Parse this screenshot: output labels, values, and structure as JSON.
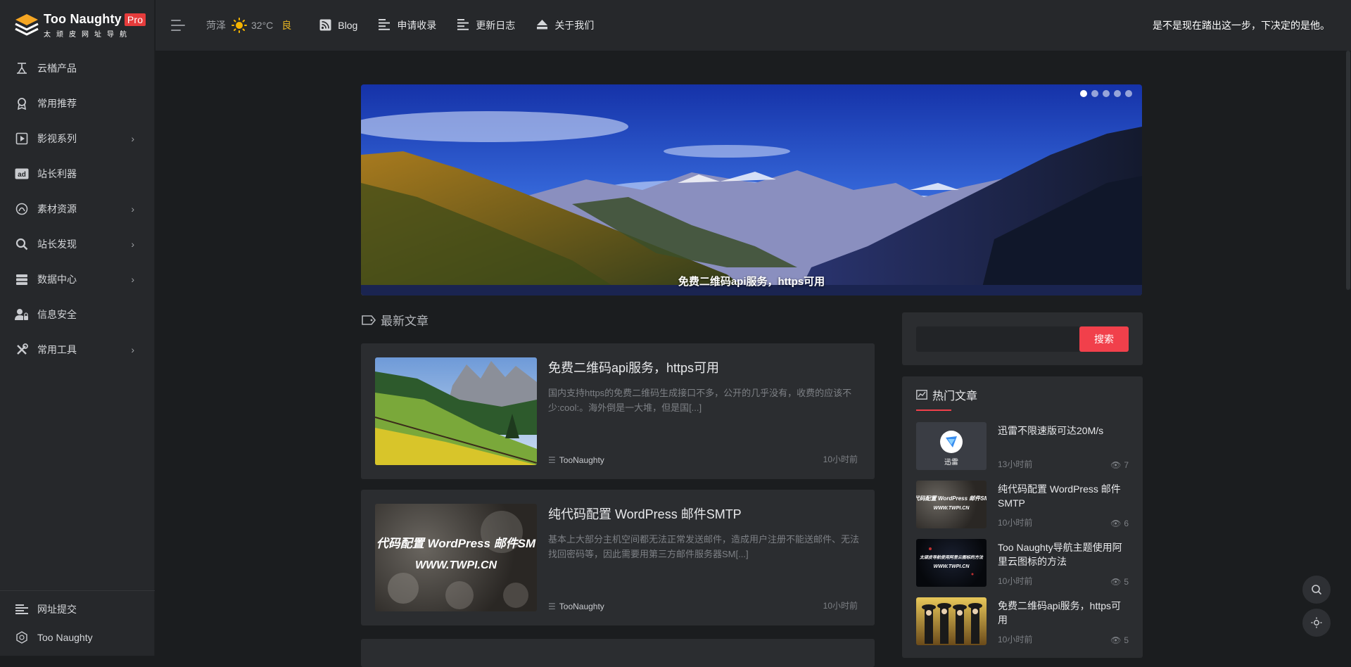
{
  "brand": {
    "title": "Too Naughty",
    "badge": "Pro",
    "subtitle": "太顽皮网址导航"
  },
  "sidebar": {
    "items": [
      {
        "label": "云楢产品",
        "icon": "cloud-product-icon",
        "has_children": false
      },
      {
        "label": "常用推荐",
        "icon": "award-icon",
        "has_children": false
      },
      {
        "label": "影视系列",
        "icon": "play-icon",
        "has_children": true
      },
      {
        "label": "站长利器",
        "icon": "ad-icon",
        "has_children": false
      },
      {
        "label": "素材资源",
        "icon": "material-icon",
        "has_children": true
      },
      {
        "label": "站长发现",
        "icon": "search-icon",
        "has_children": true
      },
      {
        "label": "数据中心",
        "icon": "database-icon",
        "has_children": true
      },
      {
        "label": "信息安全",
        "icon": "user-lock-icon",
        "has_children": false
      },
      {
        "label": "常用工具",
        "icon": "tools-icon",
        "has_children": true
      }
    ],
    "bottom": [
      {
        "label": "网址提交",
        "icon": "list-icon"
      },
      {
        "label": "Too Naughty",
        "icon": "hexagon-icon"
      }
    ],
    "chevron": "›"
  },
  "topbar": {
    "weather": {
      "city": "菏泽",
      "temp": "32°C",
      "aqi": "良"
    },
    "links": [
      {
        "label": "Blog",
        "icon": "rss-icon"
      },
      {
        "label": "申请收录",
        "icon": "align-icon"
      },
      {
        "label": "更新日志",
        "icon": "align-icon"
      },
      {
        "label": "关于我们",
        "icon": "eject-icon"
      }
    ],
    "motto": "是不是现在踏出这一步，下决定的是他。"
  },
  "banner": {
    "caption": "免费二维码api服务，https可用",
    "dots": 5,
    "active_dot": 0
  },
  "latest": {
    "title": "最新文章",
    "articles": [
      {
        "title": "免费二维码api服务，https可用",
        "excerpt": "国内支持https的免费二维码生成接口不多，公开的几乎没有，收费的应该不少:cool:。海外倒是一大堆，但是国[...]",
        "author": "TooNaughty",
        "time": "10小时前"
      },
      {
        "title": "纯代码配置 WordPress 邮件SMTP",
        "excerpt": "基本上大部分主机空间都无法正常发送邮件，造成用户注册不能送邮件、无法找回密码等，因此需要用第三方邮件服务器SM[...]",
        "author": "TooNaughty",
        "time": "10小时前",
        "thumb_text": "代码配置 WordPress 邮件SM",
        "thumb_url": "WWW.TWPI.CN"
      }
    ]
  },
  "search": {
    "placeholder": "",
    "button": "搜索"
  },
  "hot": {
    "title": "热门文章",
    "items": [
      {
        "title": "迅雷不限速版可达20M/s",
        "time": "13小时前",
        "views": "7",
        "thumb_label": "迅雷"
      },
      {
        "title": "纯代码配置 WordPress 邮件SMTP",
        "time": "10小时前",
        "views": "6",
        "thumb_text": "代码配置 WordPress 邮件SM",
        "thumb_url": "WWW.TWPI.CN"
      },
      {
        "title": "Too Naughty导航主题使用阿里云图标的方法",
        "time": "10小时前",
        "views": "5",
        "thumb_text": "太顽皮导航使用阿里云图标的方法",
        "thumb_url": "WWW.TWPI.CN"
      },
      {
        "title": "免费二维码api服务，https可用",
        "time": "10小时前",
        "views": "5"
      }
    ]
  },
  "colors": {
    "accent": "#f1404b",
    "brand_orange": "#f5a623",
    "pro_badge": "#e63c3c",
    "aqi": "#e6b422"
  }
}
